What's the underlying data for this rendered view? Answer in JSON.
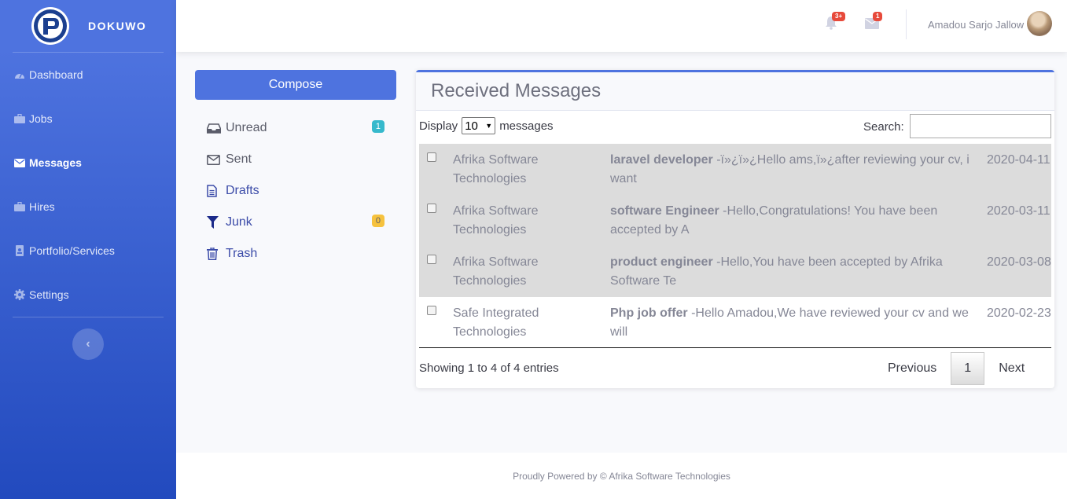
{
  "brand": {
    "name": "DOKUWO",
    "logo_icon": "dokuwo-logo"
  },
  "sidebar": {
    "items": [
      {
        "label": "Dashboard",
        "icon": "tachometer-icon",
        "active": false
      },
      {
        "label": "Jobs",
        "icon": "briefcase-icon",
        "active": false
      },
      {
        "label": "Messages",
        "icon": "envelope-icon",
        "active": true
      },
      {
        "label": "Hires",
        "icon": "briefcase-icon",
        "active": false
      },
      {
        "label": "Portfolio/Services",
        "icon": "address-book-icon",
        "active": false
      },
      {
        "label": "Settings",
        "icon": "gear-icon",
        "active": false
      }
    ],
    "toggle_label": "‹"
  },
  "topbar": {
    "alerts_badge": "3+",
    "messages_badge": "1",
    "user_name": "Amadou Sarjo Jallow"
  },
  "mailbox": {
    "compose_label": "Compose",
    "folders": [
      {
        "label": "Unread",
        "icon": "inbox-icon",
        "count": "1"
      },
      {
        "label": "Sent",
        "icon": "envelope-icon",
        "count": ""
      },
      {
        "label": "Drafts",
        "icon": "file-text-icon",
        "count": ""
      },
      {
        "label": "Junk",
        "icon": "filter-icon",
        "count": "0"
      },
      {
        "label": "Trash",
        "icon": "trash-icon",
        "count": ""
      }
    ]
  },
  "messages": {
    "title": "Received Messages",
    "display_prefix": "Display",
    "display_value": "10",
    "display_suffix": "messages",
    "search_label": "Search:",
    "search_value": "",
    "rows": [
      {
        "from": "Afrika Software Technologies",
        "subject": "laravel developer",
        "preview": " -ï»¿ï»¿Hello ams,ï»¿after reviewing your cv, i want",
        "date": "2020-04-11",
        "read": true
      },
      {
        "from": "Afrika Software Technologies",
        "subject": "software Engineer",
        "preview": " -Hello,Congratulations! You have been accepted by A",
        "date": "2020-03-11",
        "read": true
      },
      {
        "from": "Afrika Software Technologies",
        "subject": "product engineer",
        "preview": " -Hello,You have been accepted by Afrika Software Te",
        "date": "2020-03-08",
        "read": true
      },
      {
        "from": "Safe Integrated Technologies",
        "subject": "Php job offer",
        "preview": " -Hello Amadou,We have reviewed your cv and we will",
        "date": "2020-02-23",
        "read": false
      }
    ],
    "showing_text": "Showing 1 to 4 of 4 entries",
    "pagination": {
      "previous": "Previous",
      "current": "1",
      "next": "Next"
    }
  },
  "footer": {
    "text": "Proudly Powered by © Afrika Software Technologies"
  }
}
